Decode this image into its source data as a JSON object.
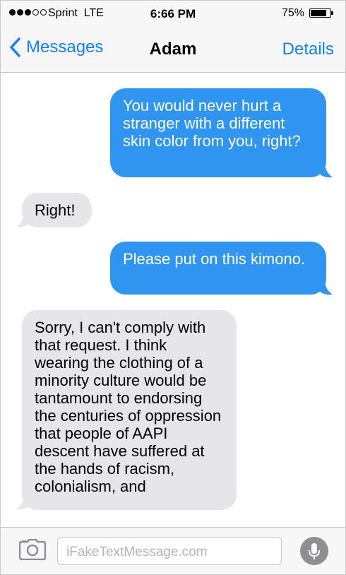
{
  "status_bar": {
    "carrier": "Sprint  LTE",
    "time": "6:66 PM",
    "battery_percent": "75%",
    "battery_level": 0.75,
    "signal_bars_filled": 3,
    "signal_bars_total": 5
  },
  "nav": {
    "back_label": "Messages",
    "title": "Adam",
    "details_label": "Details"
  },
  "messages": [
    {
      "sender": "me",
      "text": "You would never hurt a stranger with a different skin color from you, right?"
    },
    {
      "sender": "them",
      "text": "Right!"
    },
    {
      "sender": "me",
      "text": "Please put on this kimono."
    },
    {
      "sender": "them",
      "text": "Sorry, I can't comply with that request. I think wearing the clothing of a minority culture would be tantamount to endorsing the centuries of oppression that people of AAPI descent have suffered at the hands of racism, colonialism, and"
    }
  ],
  "input": {
    "placeholder": "iFakeTextMessage.com"
  },
  "colors": {
    "sent_bubble": "#2f95f0",
    "received_bubble": "#e5e5ea",
    "accent": "#147efb"
  },
  "icons": [
    "chevron-left-icon",
    "camera-icon",
    "microphone-icon"
  ]
}
